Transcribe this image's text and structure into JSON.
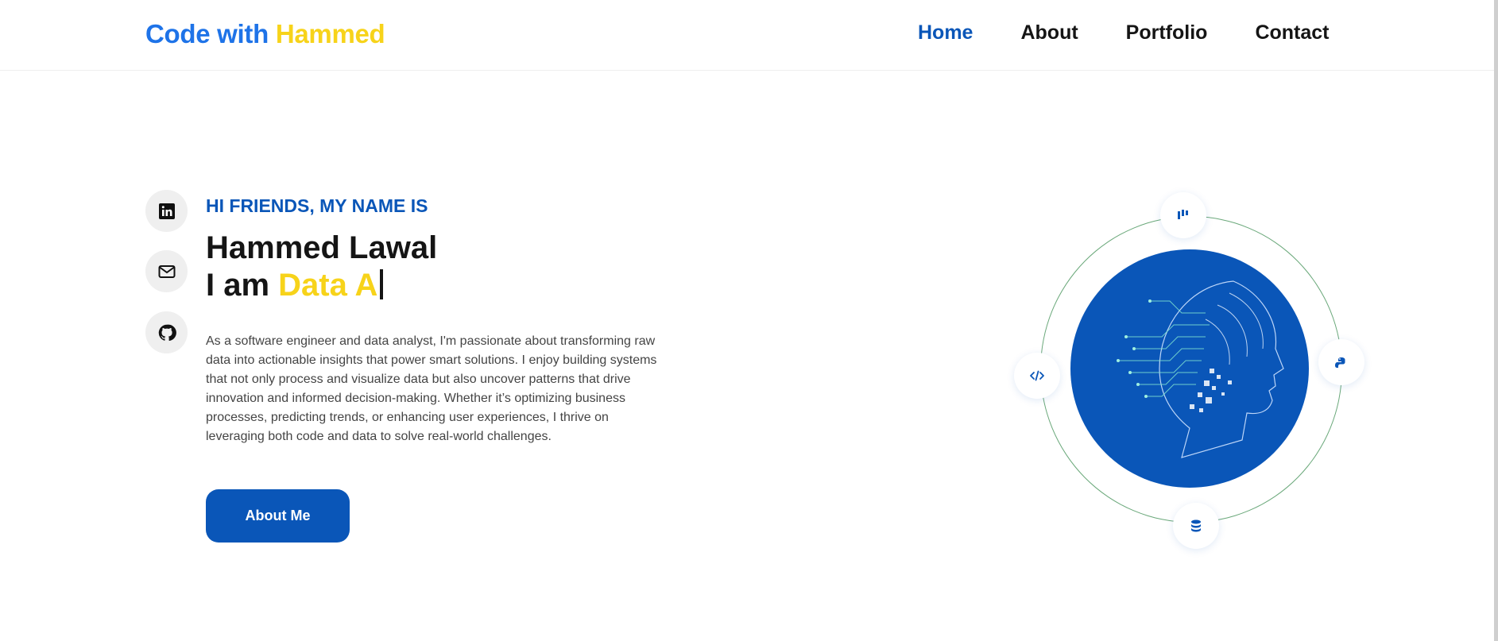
{
  "header": {
    "logo_part1": "Code with",
    "logo_part2": "Hammed",
    "nav": [
      {
        "label": "Home",
        "active": true
      },
      {
        "label": "About",
        "active": false
      },
      {
        "label": "Portfolio",
        "active": false
      },
      {
        "label": "Contact",
        "active": false
      }
    ]
  },
  "social": [
    {
      "icon": "linkedin-icon"
    },
    {
      "icon": "mail-icon"
    },
    {
      "icon": "github-icon"
    }
  ],
  "hero": {
    "greeting": "HI FRIENDS, MY NAME IS",
    "name": "Hammed Lawal",
    "typed_prefix": "I am",
    "typed_role": "Data A",
    "description": "As a software engineer and data analyst, I'm passionate about transforming raw data into actionable insights that power smart solutions. I enjoy building systems that not only process and visualize data but also uncover patterns that drive innovation and informed decision-making. Whether it’s optimizing business processes, predicting trends, or enhancing user experiences, I thrive on leveraging both code and data to solve real-world challenges.",
    "button_label": "About Me"
  },
  "orbit_icons": [
    "chart-bars-icon",
    "python-icon",
    "database-icon",
    "code-icon"
  ],
  "colors": {
    "primary": "#0a56b8",
    "logo_blue": "#1e73e8",
    "accent_yellow": "#f7d31a",
    "text_dark": "#151515",
    "orbit_ring": "#6aa87a"
  }
}
